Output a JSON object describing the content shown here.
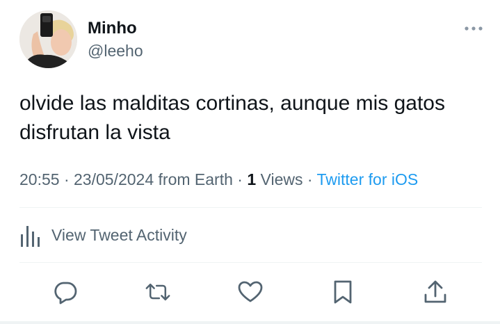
{
  "author": {
    "name": "Minho",
    "handle": "@leeho"
  },
  "tweet": {
    "text": "olvide las malditas cortinas, aunque mis gatos disfrutan la vista"
  },
  "meta": {
    "time": "20:55",
    "sep1": " · ",
    "date": "23/05/2024",
    "location": " from Earth",
    "sep2": " · ",
    "views_count": "1",
    "views_label": " Views",
    "sep3": " · ",
    "source": "Twitter for iOS"
  },
  "activity": {
    "label": "View Tweet Activity"
  },
  "icons": {
    "more": "more-horizontal-icon",
    "analytics": "analytics-bars-icon",
    "reply": "reply-bubble-icon",
    "retweet": "retweet-icon",
    "like": "heart-icon",
    "bookmark": "bookmark-icon",
    "share": "share-upload-icon"
  },
  "colors": {
    "text": "#0f1419",
    "secondary": "#536471",
    "link": "#1d9bf0",
    "divider": "#eff3f4"
  }
}
